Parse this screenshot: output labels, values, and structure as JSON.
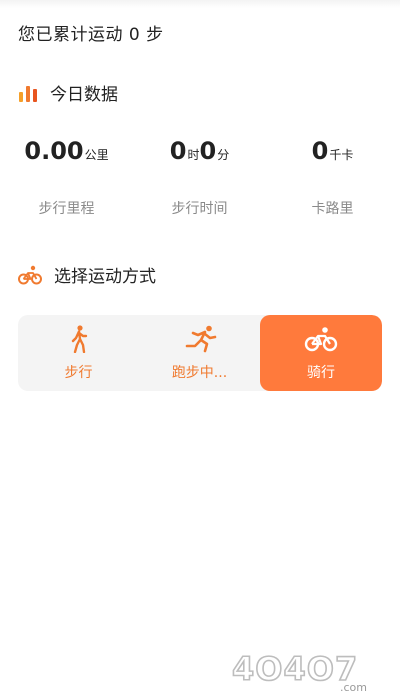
{
  "summary": {
    "total_steps_text": "您已累计运动 0 步"
  },
  "today": {
    "title": "今日数据",
    "distance": {
      "value": "0.00",
      "unit": "公里",
      "label": "步行里程"
    },
    "time": {
      "hours": "0",
      "hours_unit": "时",
      "minutes": "0",
      "minutes_unit": "分",
      "label": "步行时间"
    },
    "calories": {
      "value": "0",
      "unit": "千卡",
      "label": "卡路里"
    }
  },
  "exercise": {
    "title": "选择运动方式",
    "modes": [
      {
        "label": "步行",
        "icon": "walking-icon"
      },
      {
        "label": "跑步中...",
        "icon": "running-icon"
      },
      {
        "label": "骑行",
        "icon": "bicycle-icon",
        "selected": true
      }
    ]
  },
  "colors": {
    "accent": "#ff7a3c",
    "accent_text": "#f07a2f",
    "panel_bg": "#f4f4f4",
    "muted_text": "#8a8a8a"
  },
  "watermark": {
    "text": "4O4O7",
    "domain": ".com"
  }
}
